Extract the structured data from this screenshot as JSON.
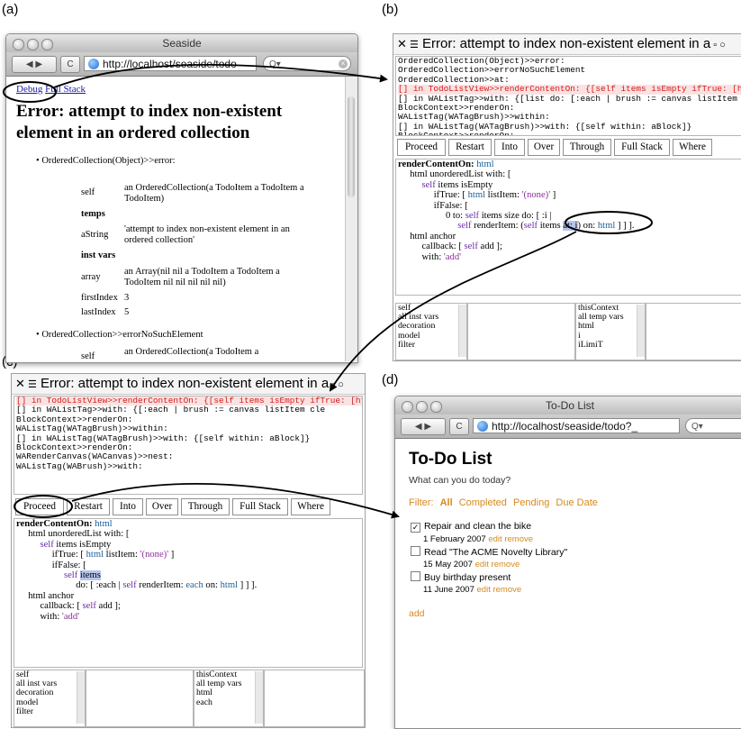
{
  "panel_labels": {
    "a": "(a)",
    "b": "(b)",
    "c": "(c)",
    "d": "(d)"
  },
  "panel_a": {
    "window_title": "Seaside",
    "url": "http://localhost/seaside/todo",
    "links": {
      "debug": "Debug",
      "full_stack": "Full Stack"
    },
    "heading": "Error: attempt to index non-existent element in an ordered collection",
    "frames": [
      {
        "title": "OrderedCollection(Object)>>error:",
        "rows": [
          {
            "label": "self",
            "value": "an OrderedCollection(a TodoItem a TodoItem a TodoItem)",
            "bold": false
          },
          {
            "label": "temps",
            "value": "",
            "bold": true
          },
          {
            "label": "aString",
            "value": "'attempt to index non-existent element in an ordered collection'",
            "bold": false
          },
          {
            "label": "inst vars",
            "value": "",
            "bold": true
          },
          {
            "label": "array",
            "value": "an Array(nil nil a TodoItem a TodoItem a TodoItem nil nil nil nil nil)",
            "bold": false
          },
          {
            "label": "firstIndex",
            "value": "3",
            "bold": false
          },
          {
            "label": "lastIndex",
            "value": "5",
            "bold": false
          }
        ]
      },
      {
        "title": "OrderedCollection>>errorNoSuchElement",
        "rows": [
          {
            "label": "self",
            "value": "an OrderedCollection(a TodoItem a",
            "bold": false
          }
        ]
      }
    ]
  },
  "panel_b": {
    "window_title": "Error: attempt to index non-existent element in a",
    "stack_lines": [
      "OrderedCollection(Object)>>error:",
      "OrderedCollection>>errorNoSuchElement",
      "OrderedCollection>>at:",
      "[] in TodoListView>>renderContentOn: {[self items isEmpty    ifTrue: [html",
      "[] in WAListTag>>with: {[list    do: [:each |    brush := canvas listItem cle",
      "BlockContext>>renderOn:",
      "WAListTag(WATagBrush)>>within:",
      "[] in WAListTag(WATagBrush)>>with: {[self within: aBlock]}",
      "BlockContext>>renderOn:"
    ],
    "highlight_index": 3,
    "buttons": [
      "Proceed",
      "Restart",
      "Into",
      "Over",
      "Through",
      "Full Stack",
      "Where"
    ],
    "code_lines": [
      [
        {
          "t": "renderContentOn: ",
          "c": "b"
        },
        {
          "t": "html",
          "c": "v"
        }
      ],
      [
        {
          "t": "     html unorderedList with: [",
          "c": ""
        }
      ],
      [
        {
          "t": "          ",
          "c": ""
        },
        {
          "t": "self",
          "c": "k"
        },
        {
          "t": " items isEmpty",
          "c": ""
        }
      ],
      [
        {
          "t": "               ifTrue: [ ",
          "c": ""
        },
        {
          "t": "html",
          "c": "v"
        },
        {
          "t": " listItem: ",
          "c": ""
        },
        {
          "t": "'(none)'",
          "c": "s"
        },
        {
          "t": " ]",
          "c": ""
        }
      ],
      [
        {
          "t": "               ifFalse: [",
          "c": ""
        }
      ],
      [
        {
          "t": "                    0 to: ",
          "c": ""
        },
        {
          "t": "self",
          "c": "k"
        },
        {
          "t": " items size do: [ :i |",
          "c": ""
        }
      ],
      [
        {
          "t": "                         ",
          "c": ""
        },
        {
          "t": "self",
          "c": "k"
        },
        {
          "t": " renderItem: (",
          "c": ""
        },
        {
          "t": "self",
          "c": "k"
        },
        {
          "t": " items ",
          "c": ""
        },
        {
          "t": "at: i",
          "c": "sel"
        },
        {
          "t": ") on: ",
          "c": ""
        },
        {
          "t": "html",
          "c": "v"
        },
        {
          "t": " ] ] ].",
          "c": ""
        }
      ],
      [
        {
          "t": "     html anchor",
          "c": ""
        }
      ],
      [
        {
          "t": "          callback: [ ",
          "c": ""
        },
        {
          "t": "self",
          "c": "k"
        },
        {
          "t": " add ];",
          "c": ""
        }
      ],
      [
        {
          "t": "          with: ",
          "c": ""
        },
        {
          "t": "'add'",
          "c": "s"
        }
      ]
    ],
    "inspector_left": [
      "self",
      "all inst vars",
      "decoration",
      "model",
      "filter"
    ],
    "inspector_right": [
      "thisContext",
      "all temp vars",
      "html",
      "i",
      "iLimiT"
    ]
  },
  "panel_c": {
    "window_title": "Error: attempt to index non-existent element in a",
    "stack_lines": [
      "[] in TodoListView>>renderContentOn: {[self items isEmpty    ifTrue: [html",
      "[] in WAListTag>>with: {[:each |    brush := canvas listItem cle",
      "BlockContext>>renderOn:",
      "WAListTag(WATagBrush)>>within:",
      "[] in WAListTag(WATagBrush)>>with: {[self within: aBlock]}",
      "BlockContext>>renderOn:",
      "WARenderCanvas(WACanvas)>>nest:",
      "WAListTag(WABrush)>>with:"
    ],
    "highlight_index": 0,
    "buttons": [
      "Proceed",
      "Restart",
      "Into",
      "Over",
      "Through",
      "Full Stack",
      "Where"
    ],
    "code_lines": [
      [
        {
          "t": "renderContentOn: ",
          "c": "b"
        },
        {
          "t": "html",
          "c": "v"
        }
      ],
      [
        {
          "t": "     html unorderedList with: [",
          "c": ""
        }
      ],
      [
        {
          "t": "          ",
          "c": ""
        },
        {
          "t": "self",
          "c": "k"
        },
        {
          "t": " items isEmpty",
          "c": ""
        }
      ],
      [
        {
          "t": "               ifTrue: [ ",
          "c": ""
        },
        {
          "t": "html",
          "c": "v"
        },
        {
          "t": " listItem: ",
          "c": ""
        },
        {
          "t": "'(none)'",
          "c": "s"
        },
        {
          "t": " ]",
          "c": ""
        }
      ],
      [
        {
          "t": "               ifFalse: [",
          "c": ""
        }
      ],
      [
        {
          "t": "                    ",
          "c": ""
        },
        {
          "t": "self",
          "c": "k"
        },
        {
          "t": " ",
          "c": ""
        },
        {
          "t": "items",
          "c": "sel"
        }
      ],
      [
        {
          "t": "                         do: [ :each | ",
          "c": ""
        },
        {
          "t": "self",
          "c": "k"
        },
        {
          "t": " renderItem: ",
          "c": ""
        },
        {
          "t": "each",
          "c": "v"
        },
        {
          "t": " on: ",
          "c": ""
        },
        {
          "t": "html",
          "c": "v"
        },
        {
          "t": " ] ] ].",
          "c": ""
        }
      ],
      [
        {
          "t": "     html anchor",
          "c": ""
        }
      ],
      [
        {
          "t": "          callback: [ ",
          "c": ""
        },
        {
          "t": "self",
          "c": "k"
        },
        {
          "t": " add ];",
          "c": ""
        }
      ],
      [
        {
          "t": "          with: ",
          "c": ""
        },
        {
          "t": "'add'",
          "c": "s"
        }
      ]
    ],
    "inspector_left": [
      "self",
      "all inst vars",
      "decoration",
      "model",
      "filter"
    ],
    "inspector_right": [
      "thisContext",
      "all temp vars",
      "html",
      "each"
    ]
  },
  "panel_d": {
    "window_title": "To-Do List",
    "url": "http://localhost/seaside/todo?_",
    "heading": "To-Do List",
    "subheading": "What can you do today?",
    "filter_label": "Filter:",
    "filters": [
      "All",
      "Completed",
      "Pending",
      "Due Date"
    ],
    "items": [
      {
        "title": "Repair and clean the bike",
        "date": "1 February 2007",
        "checked": true
      },
      {
        "title": "Read \"The ACME Novelty Library\"",
        "date": "15 May 2007",
        "checked": false
      },
      {
        "title": "Buy birthday present",
        "date": "11 June 2007",
        "checked": false
      }
    ],
    "edit_label": "edit",
    "remove_label": "remove",
    "add_label": "add"
  },
  "colors": {
    "link": "#d68a1e",
    "error_highlight": "#d51b1b",
    "code_keyword": "#6b2aa6",
    "code_string": "#8a2f9a",
    "selection": "#b6c6ec"
  }
}
